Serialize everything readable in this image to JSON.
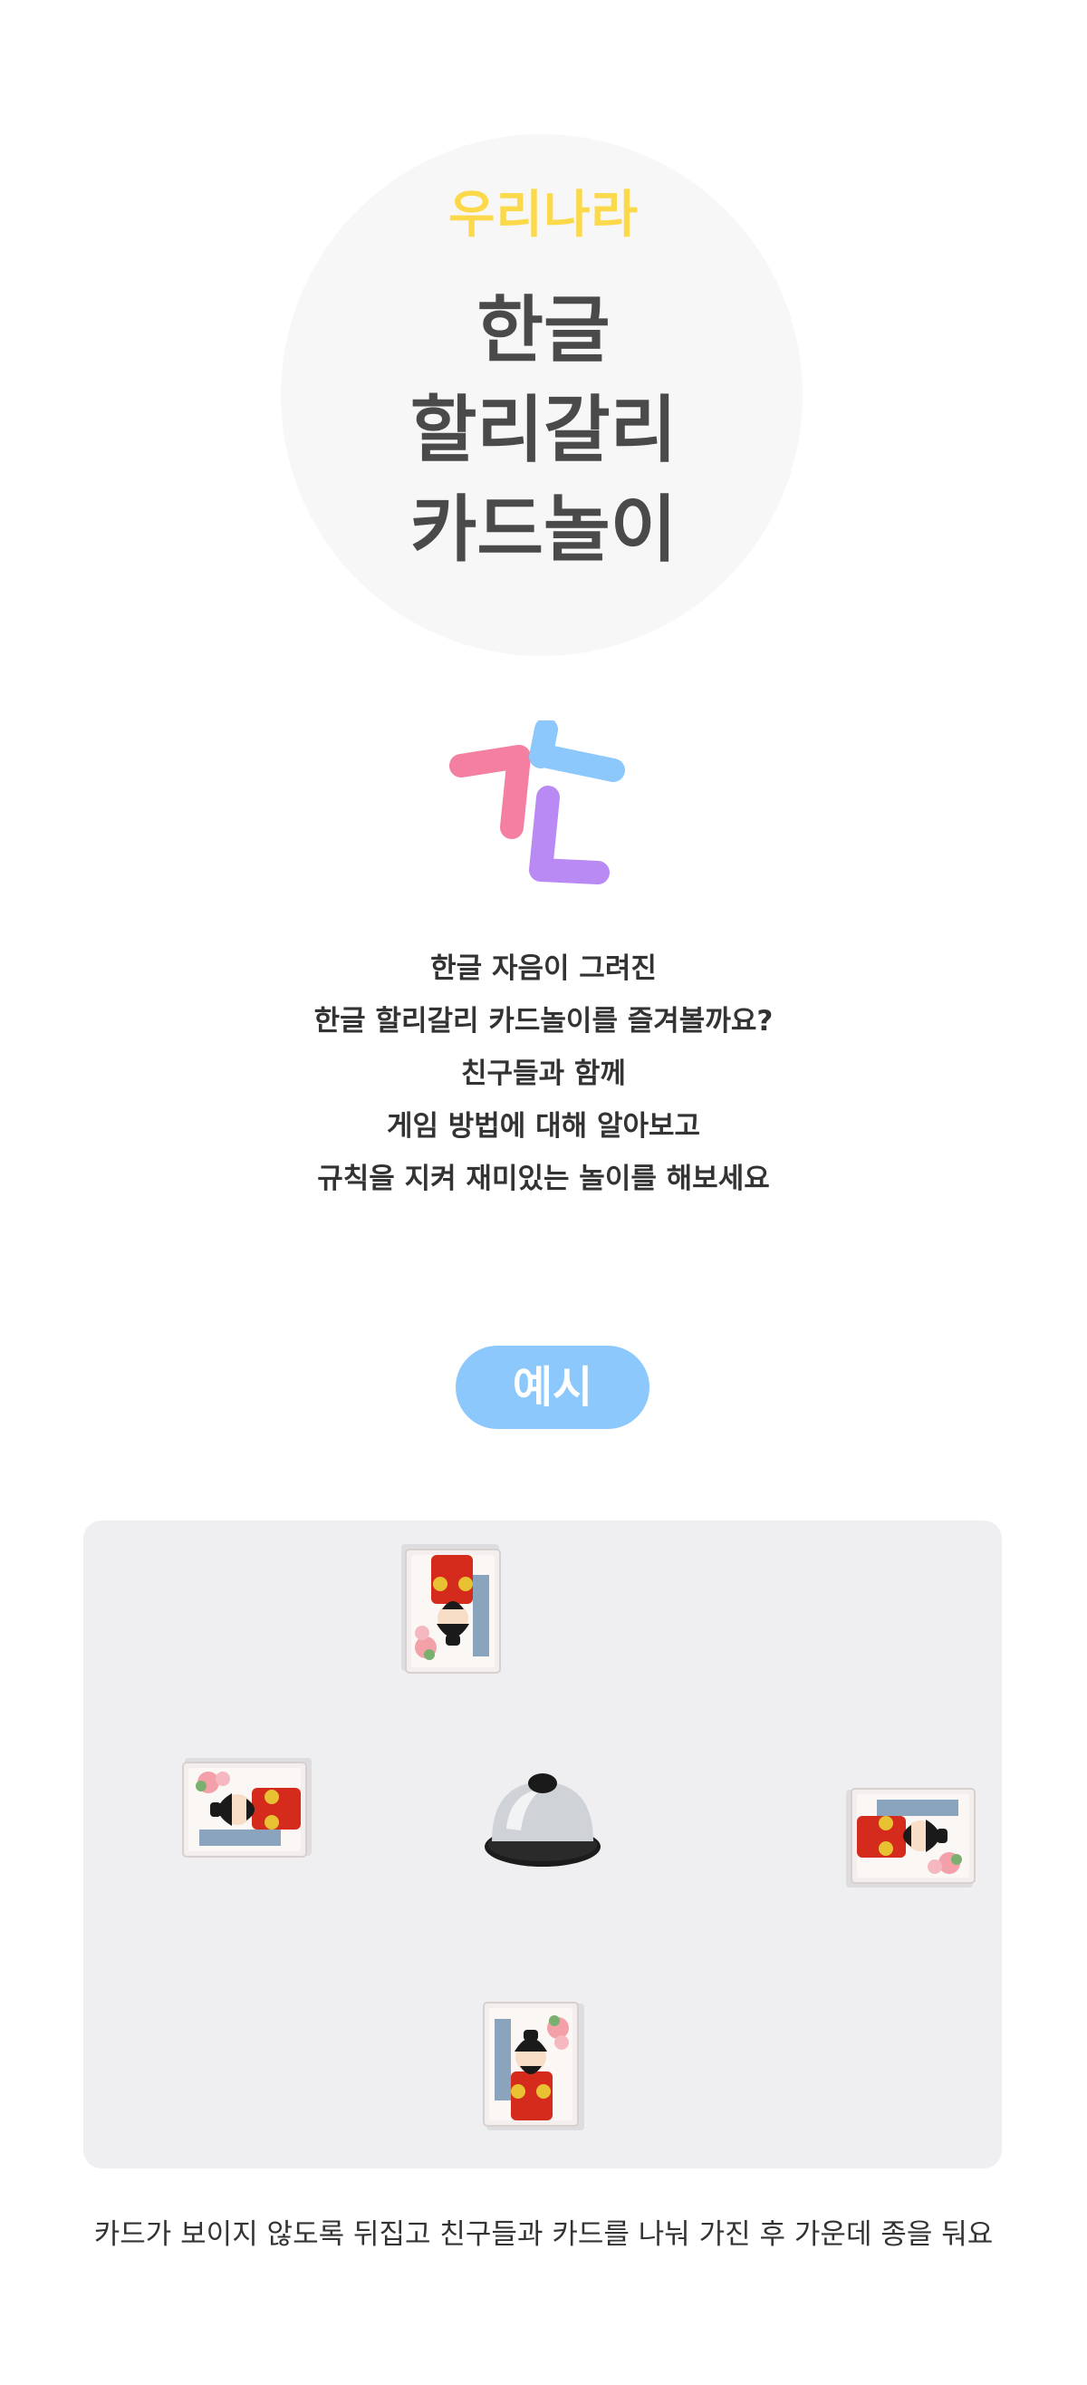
{
  "hero": {
    "subtitle": "우리나라",
    "title_lines": [
      "한글",
      "할리갈리",
      "카드놀이"
    ]
  },
  "intro": {
    "lines": [
      "한글 자음이 그려진",
      "한글 할리갈리 카드놀이를 즐겨볼까요?",
      "친구들과 함께",
      "게임 방법에 대해 알아보고",
      "규칙을 지켜 재미있는 놀이를 해보세요"
    ]
  },
  "example": {
    "label": "예시"
  },
  "caption": "카드가 보이지 않도록 뒤집고 친구들과 카드를 나눠 가진 후 가운데 종을 둬요",
  "colors": {
    "hero_subtitle": "#fbd94a",
    "hero_title": "#4a4a4a",
    "pill": "#8cc8fb",
    "logo_pink": "#f47fa0",
    "logo_blue": "#8cc8fb",
    "logo_purple": "#b98af4"
  }
}
